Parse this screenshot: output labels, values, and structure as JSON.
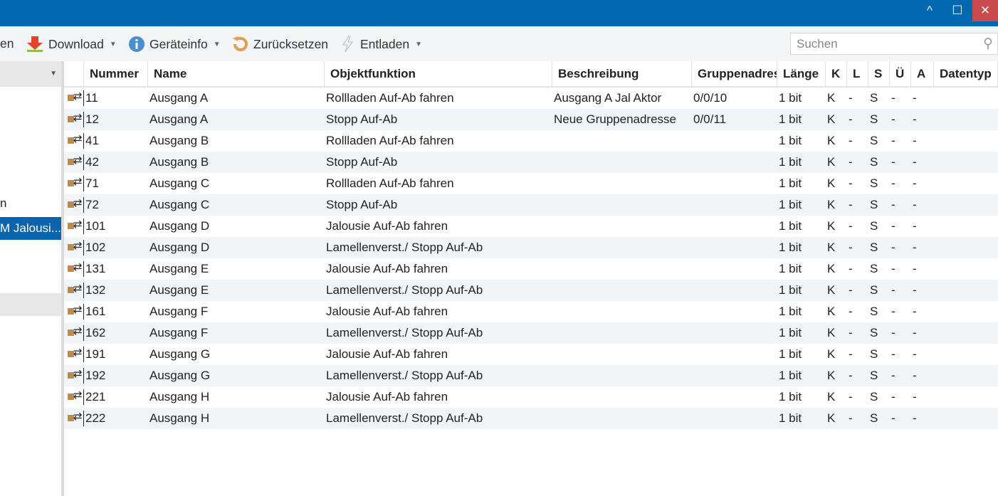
{
  "window": {
    "collapse": "^",
    "maximize": "☐",
    "close": "✕"
  },
  "toolbar": {
    "partial": "en",
    "download": "Download",
    "geraeteinfo": "Geräteinfo",
    "zuruecksetzen": "Zurücksetzen",
    "entladen": "Entladen",
    "search_placeholder": "Suchen"
  },
  "left": {
    "item_partial": "n",
    "selected": "M Jalousi..."
  },
  "columns": [
    "Nummer",
    "Name",
    "Objektfunktion",
    "Beschreibung",
    "Gruppenadres",
    "Länge",
    "K",
    "L",
    "S",
    "Ü",
    "A",
    "Datentyp"
  ],
  "rows": [
    [
      "11",
      "Ausgang A",
      "Rollladen Auf-Ab fahren",
      "Ausgang A Jal Aktor",
      "0/0/10",
      "1 bit",
      "K",
      "-",
      "S",
      "-",
      "-",
      ""
    ],
    [
      "12",
      "Ausgang A",
      "Stopp Auf-Ab",
      "Neue Gruppenadresse",
      "0/0/11",
      "1 bit",
      "K",
      "-",
      "S",
      "-",
      "-",
      ""
    ],
    [
      "41",
      "Ausgang B",
      "Rollladen Auf-Ab fahren",
      "",
      "",
      "1 bit",
      "K",
      "-",
      "S",
      "-",
      "-",
      ""
    ],
    [
      "42",
      "Ausgang B",
      "Stopp Auf-Ab",
      "",
      "",
      "1 bit",
      "K",
      "-",
      "S",
      "-",
      "-",
      ""
    ],
    [
      "71",
      "Ausgang C",
      "Rollladen Auf-Ab fahren",
      "",
      "",
      "1 bit",
      "K",
      "-",
      "S",
      "-",
      "-",
      ""
    ],
    [
      "72",
      "Ausgang C",
      "Stopp Auf-Ab",
      "",
      "",
      "1 bit",
      "K",
      "-",
      "S",
      "-",
      "-",
      ""
    ],
    [
      "101",
      "Ausgang D",
      "Jalousie Auf-Ab fahren",
      "",
      "",
      "1 bit",
      "K",
      "-",
      "S",
      "-",
      "-",
      ""
    ],
    [
      "102",
      "Ausgang D",
      "Lamellenverst./ Stopp Auf-Ab",
      "",
      "",
      "1 bit",
      "K",
      "-",
      "S",
      "-",
      "-",
      ""
    ],
    [
      "131",
      "Ausgang E",
      "Jalousie Auf-Ab fahren",
      "",
      "",
      "1 bit",
      "K",
      "-",
      "S",
      "-",
      "-",
      ""
    ],
    [
      "132",
      "Ausgang E",
      "Lamellenverst./ Stopp Auf-Ab",
      "",
      "",
      "1 bit",
      "K",
      "-",
      "S",
      "-",
      "-",
      ""
    ],
    [
      "161",
      "Ausgang F",
      "Jalousie Auf-Ab fahren",
      "",
      "",
      "1 bit",
      "K",
      "-",
      "S",
      "-",
      "-",
      ""
    ],
    [
      "162",
      "Ausgang F",
      "Lamellenverst./ Stopp Auf-Ab",
      "",
      "",
      "1 bit",
      "K",
      "-",
      "S",
      "-",
      "-",
      ""
    ],
    [
      "191",
      "Ausgang G",
      "Jalousie Auf-Ab fahren",
      "",
      "",
      "1 bit",
      "K",
      "-",
      "S",
      "-",
      "-",
      ""
    ],
    [
      "192",
      "Ausgang G",
      "Lamellenverst./ Stopp Auf-Ab",
      "",
      "",
      "1 bit",
      "K",
      "-",
      "S",
      "-",
      "-",
      ""
    ],
    [
      "221",
      "Ausgang H",
      "Jalousie Auf-Ab fahren",
      "",
      "",
      "1 bit",
      "K",
      "-",
      "S",
      "-",
      "-",
      ""
    ],
    [
      "222",
      "Ausgang H",
      "Lamellenverst./ Stopp Auf-Ab",
      "",
      "",
      "1 bit",
      "K",
      "-",
      "S",
      "-",
      "-",
      ""
    ]
  ]
}
